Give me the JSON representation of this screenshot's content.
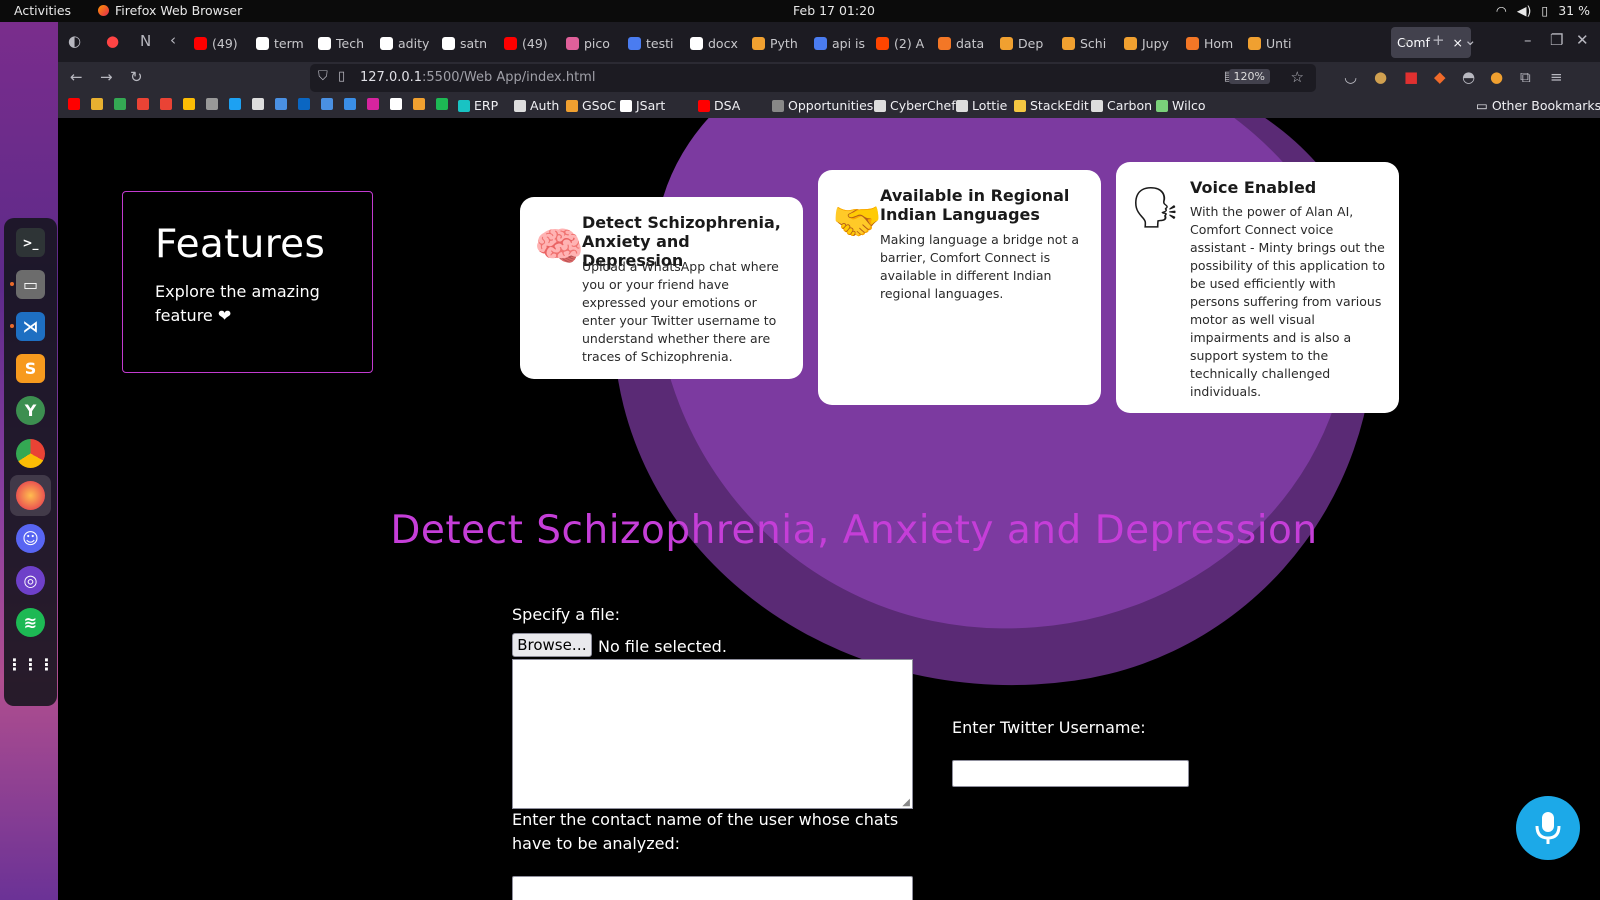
{
  "topbar": {
    "activities": "Activities",
    "app_name": "Firefox Web Browser",
    "clock": "Feb 17  01:20",
    "battery": "31 %"
  },
  "tabs": [
    {
      "label": "(49)",
      "color": "#ff0000"
    },
    {
      "label": "term",
      "color": "#ffffff"
    },
    {
      "label": "Tech",
      "color": "#ffffff"
    },
    {
      "label": "adity",
      "color": "#ffffff"
    },
    {
      "label": "satn",
      "color": "#ffffff"
    },
    {
      "label": "(49)",
      "color": "#ff0000"
    },
    {
      "label": "pico",
      "color": "#e0609a"
    },
    {
      "label": "testi",
      "color": "#4a7cf0"
    },
    {
      "label": "docx",
      "color": "#ffffff"
    },
    {
      "label": "Pyth",
      "color": "#f0a030"
    },
    {
      "label": "api is",
      "color": "#4a7cf0"
    },
    {
      "label": "(2) A",
      "color": "#ff4500"
    },
    {
      "label": "data",
      "color": "#f37726"
    },
    {
      "label": "Dep",
      "color": "#f0a030"
    },
    {
      "label": "Schi",
      "color": "#f0a030"
    },
    {
      "label": "Jupy",
      "color": "#f0a030"
    },
    {
      "label": "Hom",
      "color": "#f37726"
    },
    {
      "label": "Unti",
      "color": "#f0a030"
    }
  ],
  "active_tab": {
    "label": "Comf",
    "close": "×"
  },
  "navbar": {
    "url_host": "127.0.0.1",
    "url_path": ":5500/Web App/index.html",
    "zoom": "120%"
  },
  "bookmarks": [
    {
      "label": "ERP",
      "color": "#19c3c3"
    },
    {
      "label": "Auth",
      "color": "#dddddd"
    },
    {
      "label": "GSoC",
      "color": "#f0a030"
    },
    {
      "label": "JSart",
      "color": "#ffffff"
    },
    {
      "label": "DSA",
      "color": "#ff0000"
    },
    {
      "label": "Opportunities",
      "color": "#888888"
    },
    {
      "label": "CyberChef",
      "color": "#dddddd"
    },
    {
      "label": "Lottie",
      "color": "#dddddd"
    },
    {
      "label": "StackEdit",
      "color": "#f5c842"
    },
    {
      "label": "Carbon",
      "color": "#dddddd"
    },
    {
      "label": "Wilco",
      "color": "#7ad07a"
    }
  ],
  "other_bookmarks": "Other Bookmarks",
  "features": {
    "title": "Features",
    "subtitle": "Explore the amazing feature ❤"
  },
  "cards": [
    {
      "icon": "🧠",
      "title": "Detect Schizophrenia, Anxiety and Depression",
      "text": "Upload a WhatsApp chat where you or your friend have expressed your emotions or enter your Twitter username to understand whether there are traces of Schizophrenia."
    },
    {
      "icon": "🤝",
      "title": "Available in Regional Indian Languages",
      "text": "Making language a bridge not a barrier, Comfort Connect is available in different Indian regional languages."
    },
    {
      "icon": "🗣",
      "title": "Voice Enabled",
      "text": "With the power of Alan AI, Comfort Connect voice assistant - Minty brings out the possibility of this application to be used efficiently with persons suffering from various motor as well visual impairments and is also a support system to the technically challenged individuals."
    }
  ],
  "detect": {
    "title": "Detect Schizophrenia, Anxiety and Depression",
    "file_label": "Specify a file:",
    "browse_button": "Browse…",
    "no_file": "No file selected.",
    "contact_label": "Enter the contact name of the user whose chats have to be analyzed:",
    "twitter_label": "Enter Twitter Username:"
  },
  "colors": {
    "accent": "#c53ed8",
    "blob": "#7c3aa0",
    "mic": "#1ca9e8"
  }
}
